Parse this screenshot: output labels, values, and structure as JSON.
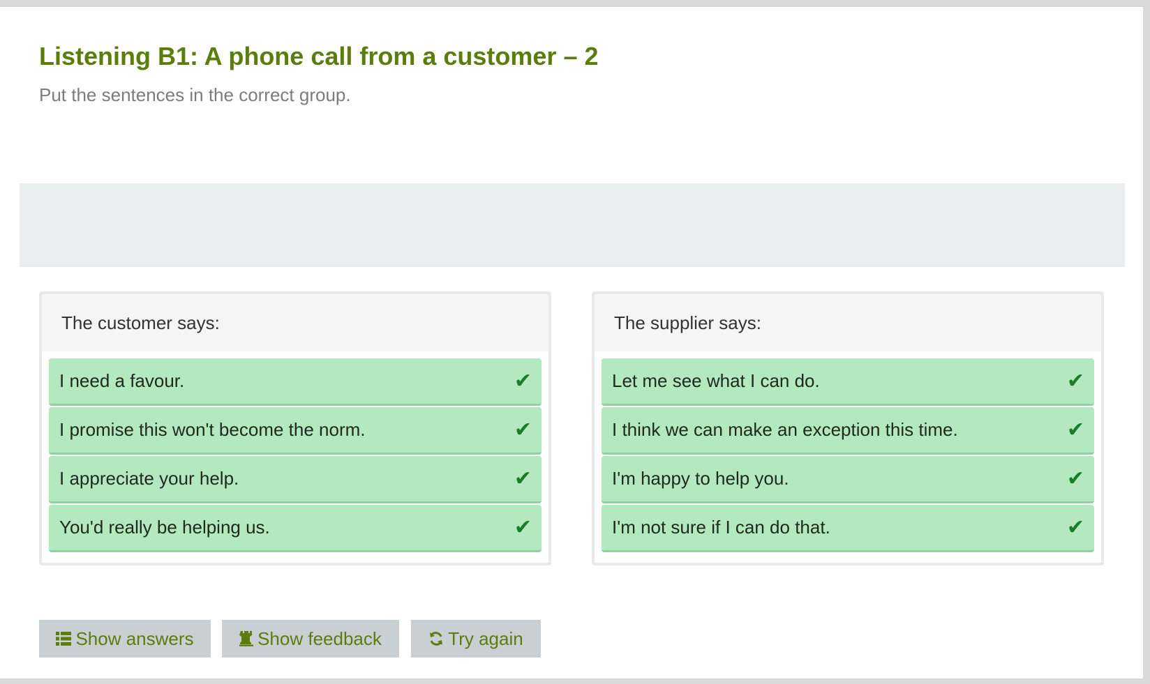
{
  "title": "Listening B1: A phone call from a customer – 2",
  "instruction": "Put the sentences in the correct group.",
  "groups": [
    {
      "header": "The customer says:",
      "items": [
        {
          "text": "I need a favour.",
          "status": "correct",
          "icon": "check-icon"
        },
        {
          "text": "I promise this won't become the norm.",
          "status": "correct",
          "icon": "check-icon"
        },
        {
          "text": "I appreciate your help.",
          "status": "correct",
          "icon": "check-icon"
        },
        {
          "text": "You'd really be helping us.",
          "status": "correct",
          "icon": "check-icon"
        }
      ]
    },
    {
      "header": "The supplier says:",
      "items": [
        {
          "text": "Let me see what I can do.",
          "status": "correct",
          "icon": "check-icon"
        },
        {
          "text": "I think we can make an exception this time.",
          "status": "correct",
          "icon": "check-icon"
        },
        {
          "text": "I'm happy to help you.",
          "status": "correct",
          "icon": "check-icon"
        },
        {
          "text": "I'm not sure if I can do that.",
          "status": "correct",
          "icon": "check-icon"
        }
      ]
    }
  ],
  "buttons": {
    "show_answers": {
      "label": "Show answers",
      "icon": "list-icon"
    },
    "show_feedback": {
      "label": "Show feedback",
      "icon": "rook-icon"
    },
    "try_again": {
      "label": "Try again",
      "icon": "refresh-icon"
    }
  },
  "colors": {
    "title": "#5a7d0c",
    "correct_bg": "#b4e8bf",
    "check": "#1a7d2a",
    "button_bg": "#c8d0d4"
  }
}
